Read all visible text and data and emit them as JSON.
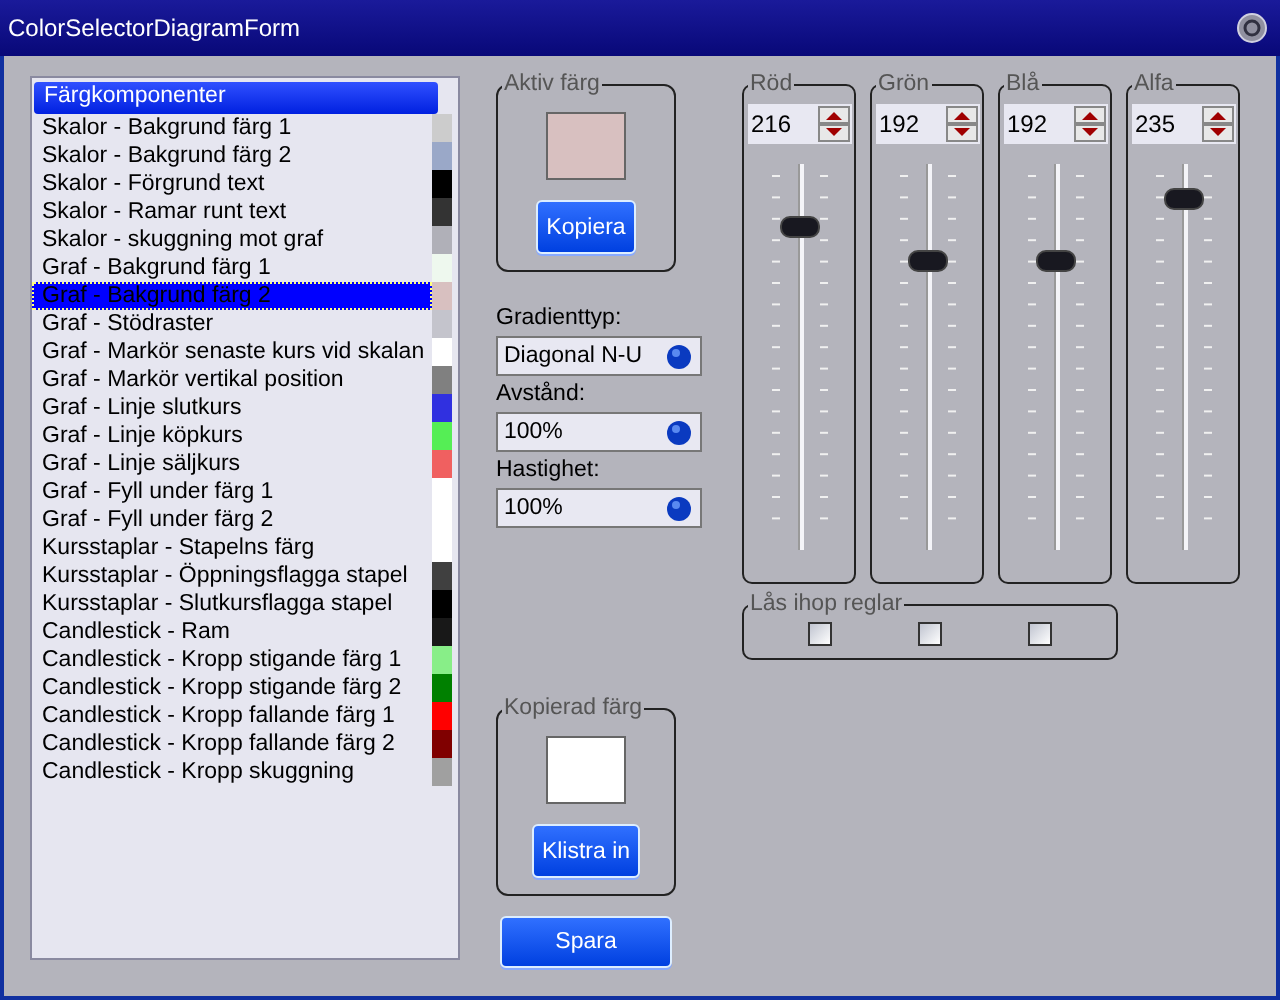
{
  "window": {
    "title": "ColorSelectorDiagramForm"
  },
  "component_list": {
    "header": "Färgkomponenter",
    "items": [
      {
        "label": "Skalor - Bakgrund färg 1",
        "color": "#cccccc",
        "selected": false
      },
      {
        "label": "Skalor - Bakgrund färg 2",
        "color": "#9aa8c8",
        "selected": false
      },
      {
        "label": "Skalor - Förgrund text",
        "color": "#000000",
        "selected": false
      },
      {
        "label": "Skalor - Ramar runt text",
        "color": "#333333",
        "selected": false
      },
      {
        "label": "Skalor - skuggning mot graf",
        "color": "#b0b0b8",
        "selected": false
      },
      {
        "label": "Graf - Bakgrund färg 1",
        "color": "#eef8ee",
        "selected": false
      },
      {
        "label": "Graf - Bakgrund färg 2",
        "color": "#d8c0c0",
        "selected": true
      },
      {
        "label": "Graf - Stödraster",
        "color": "#c4c4cc",
        "selected": false
      },
      {
        "label": "Graf - Markör senaste kurs vid skalan",
        "color": "#ffffff",
        "selected": false
      },
      {
        "label": "Graf - Markör vertikal position",
        "color": "#808080",
        "selected": false
      },
      {
        "label": "Graf - Linje slutkurs",
        "color": "#3030e0",
        "selected": false
      },
      {
        "label": "Graf - Linje köpkurs",
        "color": "#55ee55",
        "selected": false
      },
      {
        "label": "Graf - Linje säljkurs",
        "color": "#f06060",
        "selected": false
      },
      {
        "label": "Graf - Fyll under färg 1",
        "color": "#ffffff",
        "selected": false
      },
      {
        "label": "Graf - Fyll under färg 2",
        "color": "#ffffff",
        "selected": false
      },
      {
        "label": "Kursstaplar - Stapelns färg",
        "color": "#ffffff",
        "selected": false
      },
      {
        "label": "Kursstaplar - Öppningsflagga stapel",
        "color": "#404040",
        "selected": false
      },
      {
        "label": "Kursstaplar - Slutkursflagga stapel",
        "color": "#000000",
        "selected": false
      },
      {
        "label": "Candlestick - Ram",
        "color": "#181818",
        "selected": false
      },
      {
        "label": "Candlestick - Kropp stigande färg 1",
        "color": "#88ee88",
        "selected": false
      },
      {
        "label": "Candlestick - Kropp stigande färg 2",
        "color": "#008000",
        "selected": false
      },
      {
        "label": "Candlestick - Kropp fallande färg 1",
        "color": "#ff0000",
        "selected": false
      },
      {
        "label": "Candlestick - Kropp fallande färg 2",
        "color": "#800000",
        "selected": false
      },
      {
        "label": "Candlestick - Kropp skuggning",
        "color": "#a0a0a0",
        "selected": false
      }
    ]
  },
  "active_color": {
    "title": "Aktiv färg",
    "color": "#d8c0c0",
    "button": "Kopiera"
  },
  "fields": [
    {
      "label": "Gradienttyp:",
      "value": "Diagonal N-U"
    },
    {
      "label": "Avstånd:",
      "value": "100%"
    },
    {
      "label": "Hastighet:",
      "value": "100%"
    }
  ],
  "copied_color": {
    "title": "Kopierad färg",
    "color": "#ffffff",
    "button": "Klistra in"
  },
  "save_button": "Spara",
  "sliders": [
    {
      "label": "Röd",
      "value": "216",
      "level": 0.847
    },
    {
      "label": "Grön",
      "value": "192",
      "level": 0.753
    },
    {
      "label": "Blå",
      "value": "192",
      "level": 0.753
    },
    {
      "label": "Alfa",
      "value": "235",
      "level": 0.922
    }
  ],
  "lock": {
    "title": "Lås ihop reglar",
    "checkboxes": [
      {
        "checked": false
      },
      {
        "checked": false
      },
      {
        "checked": false
      }
    ]
  }
}
